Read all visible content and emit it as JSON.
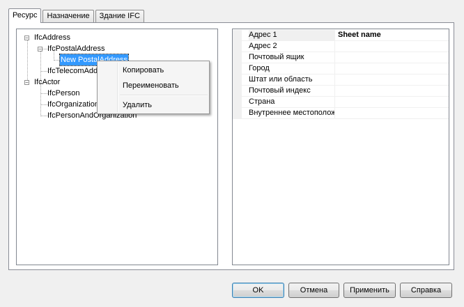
{
  "tabs": [
    {
      "label": "Ресурс",
      "active": true
    },
    {
      "label": "Назначение",
      "active": false
    },
    {
      "label": "Здание IFC",
      "active": false
    }
  ],
  "tree": {
    "nodes": [
      {
        "label": "IfcAddress",
        "expander": "−"
      },
      {
        "label": "IfcPostalAddress",
        "expander": "−"
      },
      {
        "label": "New PostalAddress",
        "selected": true
      },
      {
        "label": "IfcTelecomAddress"
      },
      {
        "label": "IfcActor",
        "expander": "−"
      },
      {
        "label": "IfcPerson"
      },
      {
        "label": "IfcOrganization"
      },
      {
        "label": "IfcPersonAndOrganization"
      }
    ]
  },
  "properties": [
    {
      "name": "Адрес 1",
      "value": "Sheet name"
    },
    {
      "name": "Адрес 2",
      "value": ""
    },
    {
      "name": "Почтовый ящик",
      "value": ""
    },
    {
      "name": "Город",
      "value": ""
    },
    {
      "name": "Штат или область",
      "value": ""
    },
    {
      "name": "Почтовый индекс",
      "value": ""
    },
    {
      "name": "Страна",
      "value": ""
    },
    {
      "name": "Внутреннее местоположение",
      "value": ""
    }
  ],
  "context_menu": {
    "items": [
      {
        "label": "Копировать"
      },
      {
        "label": "Переименовать"
      },
      {
        "label": "Удалить"
      }
    ]
  },
  "buttons": {
    "ok": "OK",
    "cancel": "Отмена",
    "apply": "Применить",
    "help": "Справка"
  }
}
